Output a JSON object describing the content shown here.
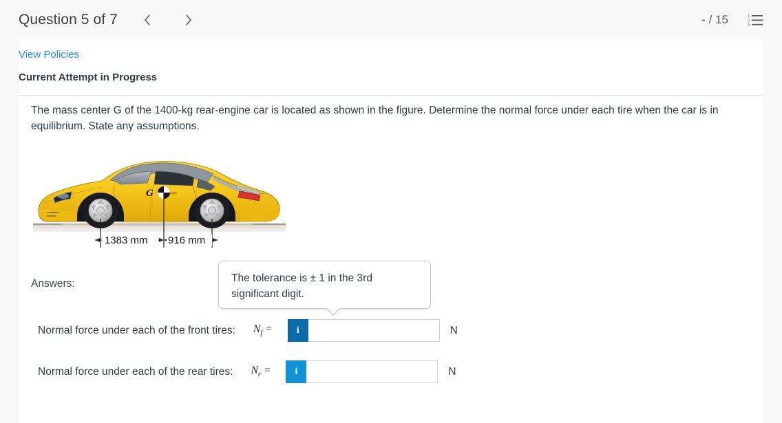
{
  "header": {
    "question_title": "Question 5 of 7",
    "prev_icon": "chevron-left-icon",
    "next_icon": "chevron-right-icon",
    "score": "- / 15",
    "list_icon": "numbered-list-icon"
  },
  "policies": {
    "view_policies_label": "View Policies",
    "attempt_status": "Current Attempt in Progress"
  },
  "question": {
    "text": "The mass center G of the 1400-kg rear-engine car is located as shown in the figure. Determine the normal force under each tire when the car is in equilibrium. State any assumptions."
  },
  "figure": {
    "name": "rear-engine-car-diagram",
    "center_of_mass_label": "G",
    "dim_front": "1383 mm",
    "dim_rear": "916 mm",
    "car_color": "#f5c518",
    "ground_color": "#b7a99a"
  },
  "tooltip": {
    "text": "The tolerance is ± 1 in the 3rd significant digit."
  },
  "answers": {
    "heading": "Answers:",
    "rows": [
      {
        "label": "Normal force under each of the front tires:",
        "symbol": "N",
        "subscript": "f",
        "equals": "=",
        "info_icon": "info-icon",
        "info_label": "i",
        "info_color": "#0b6ba8",
        "value": "",
        "placeholder": "",
        "unit": "N"
      },
      {
        "label": "Normal force under each of the rear tires:",
        "symbol": "N",
        "subscript": "r",
        "equals": "=",
        "info_icon": "info-icon",
        "info_label": "i",
        "info_color": "#1191d6",
        "value": "",
        "placeholder": "",
        "unit": "N"
      }
    ]
  }
}
